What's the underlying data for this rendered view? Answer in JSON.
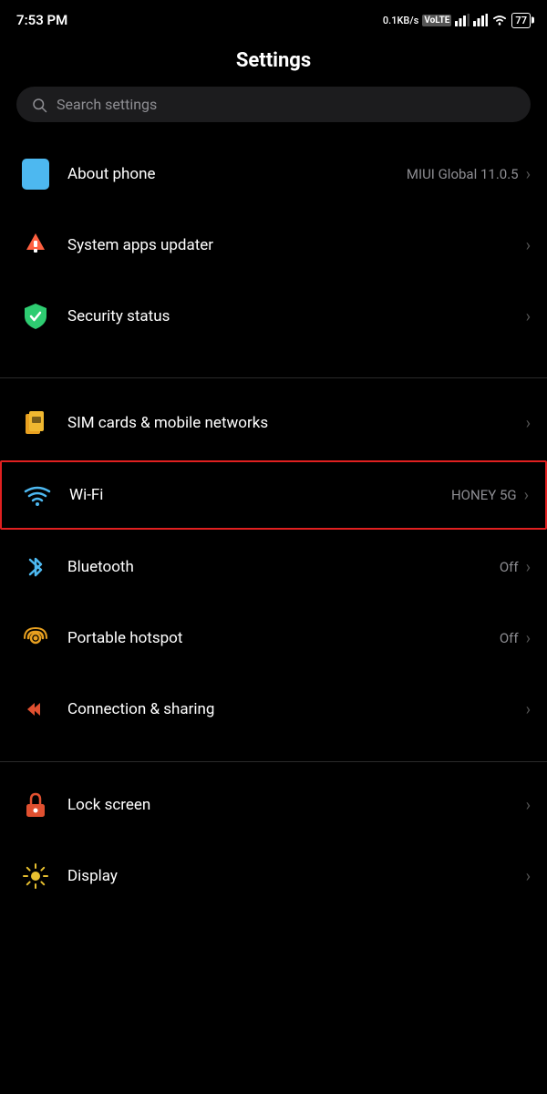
{
  "statusBar": {
    "time": "7:53 PM",
    "speed": "0.1KB/s",
    "networkType": "VoLTE",
    "battery": "77"
  },
  "page": {
    "title": "Settings"
  },
  "search": {
    "placeholder": "Search settings"
  },
  "sections": [
    {
      "id": "top",
      "items": [
        {
          "id": "about-phone",
          "label": "About phone",
          "value": "MIUI Global 11.0.5",
          "icon": "phone-icon",
          "hasChevron": true
        },
        {
          "id": "system-apps-updater",
          "label": "System apps updater",
          "value": "",
          "icon": "update-icon",
          "hasChevron": true
        },
        {
          "id": "security-status",
          "label": "Security status",
          "value": "",
          "icon": "shield-icon",
          "hasChevron": true
        }
      ]
    },
    {
      "id": "connectivity",
      "items": [
        {
          "id": "sim-cards",
          "label": "SIM cards & mobile networks",
          "value": "",
          "icon": "sim-icon",
          "hasChevron": true
        },
        {
          "id": "wifi",
          "label": "Wi-Fi",
          "value": "HONEY 5G",
          "icon": "wifi-icon",
          "hasChevron": true,
          "highlighted": true
        },
        {
          "id": "bluetooth",
          "label": "Bluetooth",
          "value": "Off",
          "icon": "bluetooth-icon",
          "hasChevron": true
        },
        {
          "id": "portable-hotspot",
          "label": "Portable hotspot",
          "value": "Off",
          "icon": "hotspot-icon",
          "hasChevron": true
        },
        {
          "id": "connection-sharing",
          "label": "Connection & sharing",
          "value": "",
          "icon": "connection-icon",
          "hasChevron": true
        }
      ]
    },
    {
      "id": "display",
      "items": [
        {
          "id": "lock-screen",
          "label": "Lock screen",
          "value": "",
          "icon": "lock-icon",
          "hasChevron": true
        },
        {
          "id": "display",
          "label": "Display",
          "value": "",
          "icon": "display-icon",
          "hasChevron": true
        }
      ]
    }
  ]
}
